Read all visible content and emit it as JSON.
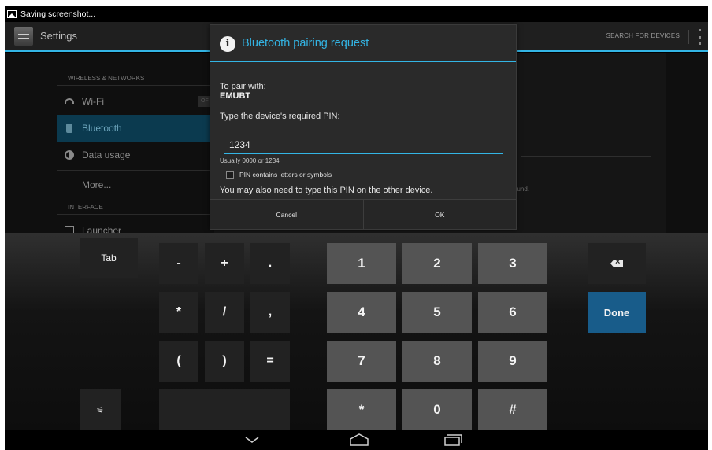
{
  "status_bar": {
    "text": "Saving screenshot..."
  },
  "action_bar": {
    "title": "Settings",
    "search_devices": "SEARCH FOR DEVICES",
    "overflow_icon": "overflow-menu-icon"
  },
  "settings": {
    "sections": [
      {
        "header": "WIRELESS & NETWORKS"
      },
      {
        "header": "INTERFACE"
      }
    ],
    "items": [
      {
        "label": "Wi-Fi",
        "icon": "wifi-icon",
        "toggle": "OF"
      },
      {
        "label": "Bluetooth",
        "icon": "bluetooth-icon",
        "selected": true
      },
      {
        "label": "Data usage",
        "icon": "data-usage-icon"
      },
      {
        "label": "More...",
        "icon": ""
      },
      {
        "label": "Launcher",
        "icon": "launcher-icon"
      }
    ],
    "right_fragment": "ound."
  },
  "dialog": {
    "title": "Bluetooth pairing request",
    "title_icon": "info-icon",
    "pair_with_label": "To pair with:",
    "device_name": "EMUBT",
    "pin_prompt": "Type the device's required PIN:",
    "pin_value": "1234",
    "hint": "Usually 0000 or 1234",
    "checkbox_label": "PIN contains letters or symbols",
    "checkbox_checked": false,
    "also_text": "You may also need to type this PIN on the other device.",
    "cancel_label": "Cancel",
    "ok_label": "OK",
    "accent_color": "#33b5e5"
  },
  "keyboard": {
    "tab": "Tab",
    "symbols": [
      "-",
      "+",
      ".",
      "*",
      "/",
      ",",
      "(",
      ")",
      "="
    ],
    "digits": [
      "1",
      "2",
      "3",
      "4",
      "5",
      "6",
      "7",
      "8",
      "9"
    ],
    "bottom_row": [
      "*",
      "0",
      "#"
    ],
    "done": "Done",
    "settings_key": "⚟",
    "backspace_icon": "backspace-icon",
    "done_color": "#185c8a"
  },
  "nav_bar": {
    "back_icon": "back-chevron-icon",
    "home_icon": "home-icon",
    "recents_icon": "recent-apps-icon"
  }
}
